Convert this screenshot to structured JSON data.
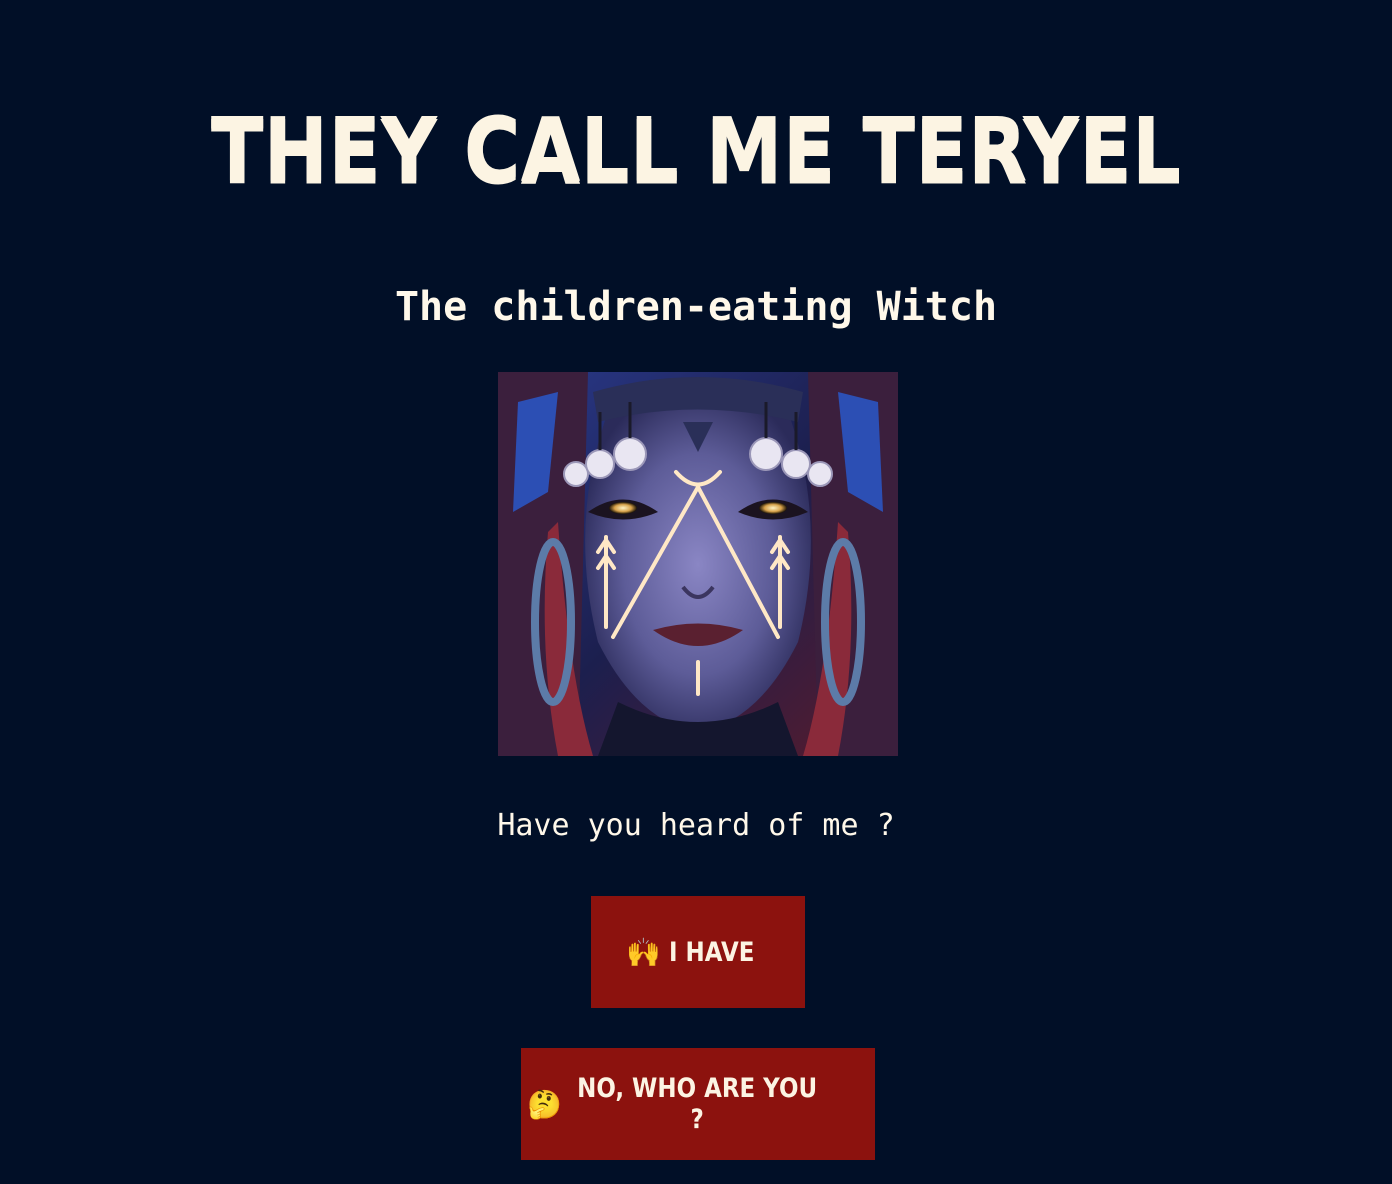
{
  "header": {
    "title": "THEY CALL ME TERYEL",
    "subtitle": "The children-eating Witch"
  },
  "portrait": {
    "alt": "Portrait of Teryel the witch with glowing eyes and face markings"
  },
  "prompt": {
    "question": "Have you heard of me ?"
  },
  "buttons": {
    "yes": {
      "emoji": "🙌",
      "label": "I HAVE"
    },
    "no": {
      "emoji": "🤔",
      "label": "NO, WHO ARE YOU ?"
    }
  },
  "colors": {
    "background": "#010f27",
    "text": "#fff8ea",
    "button": "#8c120e",
    "skin": "#6a6aa6",
    "glow": "#ffe2b8"
  }
}
